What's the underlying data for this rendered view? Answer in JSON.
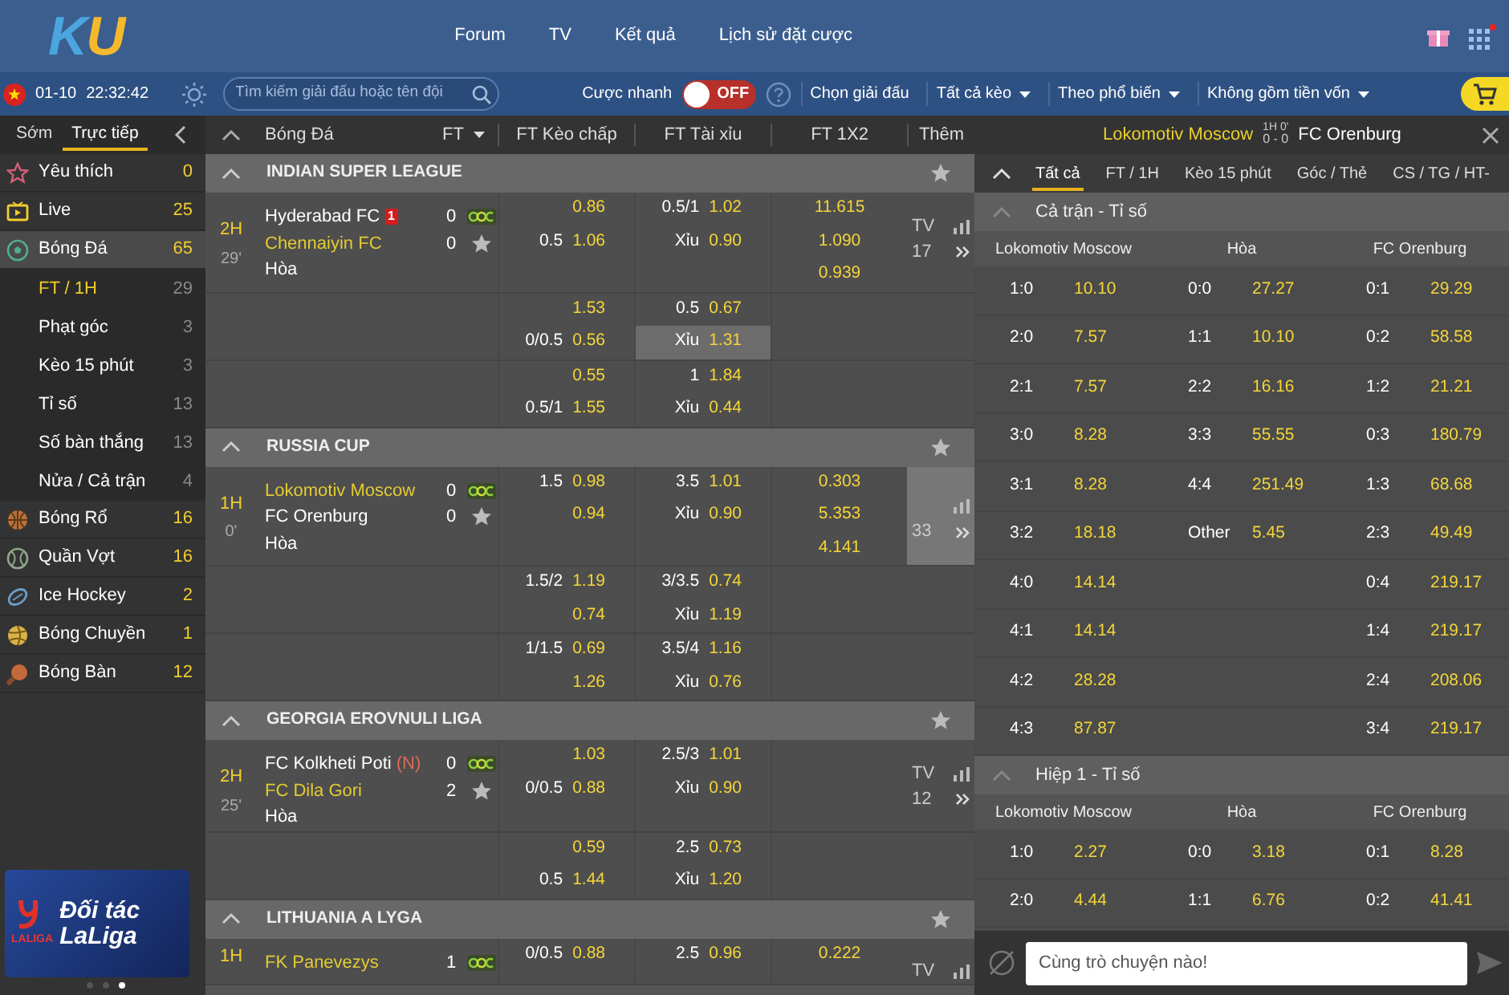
{
  "header": {
    "logo": "KU",
    "nav": [
      "Forum",
      "TV",
      "Kết quả",
      "Lịch sử đặt cược"
    ],
    "apps_badge": true
  },
  "toolbar": {
    "date": "01-10",
    "time": "22:32:42",
    "search": {
      "placeholder": "Tìm kiếm giải đấu hoặc tên đội"
    },
    "quick_bet": {
      "label": "Cược nhanh",
      "on": false,
      "state_label": "OFF"
    },
    "filters": [
      {
        "label": "Chọn giải đấu",
        "dropdown": false
      },
      {
        "label": "Tất cả kèo",
        "dropdown": true
      },
      {
        "label": "Theo phổ biến",
        "dropdown": true
      },
      {
        "label": "Không gồm tiền vốn",
        "dropdown": true
      }
    ]
  },
  "sidebar": {
    "tabs": [
      {
        "label": "Sớm",
        "selected": false
      },
      {
        "label": "Trực tiếp",
        "selected": true
      }
    ],
    "items": [
      {
        "kind": "favorites",
        "label": "Yêu thích",
        "count": "0",
        "selected": false
      },
      {
        "kind": "live",
        "label": "Live",
        "count": "25",
        "selected": false
      },
      {
        "kind": "football",
        "label": "Bóng Đá",
        "count": "65",
        "selected": true,
        "children": [
          {
            "label": "FT / 1H",
            "count": "29",
            "selected": true
          },
          {
            "label": "Phạt góc",
            "count": "3",
            "selected": false
          },
          {
            "label": "Kèo 15 phút",
            "count": "3",
            "selected": false
          },
          {
            "label": "Tỉ số",
            "count": "13",
            "selected": false
          },
          {
            "label": "Số bàn thắng",
            "count": "13",
            "selected": false
          },
          {
            "label": "Nửa / Cả trận",
            "count": "4",
            "selected": false
          }
        ]
      },
      {
        "kind": "basketball",
        "label": "Bóng Rổ",
        "count": "16",
        "selected": false
      },
      {
        "kind": "tennis",
        "label": "Quần Vợt",
        "count": "16",
        "selected": false
      },
      {
        "kind": "hockey",
        "label": "Ice Hockey",
        "count": "2",
        "selected": false
      },
      {
        "kind": "volleyball",
        "label": "Bóng Chuyền",
        "count": "1",
        "selected": false
      },
      {
        "kind": "tabletennis",
        "label": "Bóng Bàn",
        "count": "12",
        "selected": false
      }
    ],
    "banner": {
      "brand": "LALIGA",
      "title": "Đối tác LaLiga",
      "dots": [
        {
          "selected": false
        },
        {
          "selected": false
        },
        {
          "selected": true
        }
      ]
    }
  },
  "table": {
    "sport": "Bóng Đá",
    "period_filter": "FT",
    "columns": [
      "FT Kèo chấp",
      "FT Tài xỉu",
      "FT 1X2",
      "Thêm"
    ],
    "leagues": [
      {
        "name": "INDIAN SUPER LEAGUE",
        "expanded": true,
        "match": {
          "period": "2H",
          "minute": "29'",
          "teams": [
            {
              "name": "Hyderabad FC",
              "score": "0",
              "favorite": false,
              "red_cards": "1"
            },
            {
              "name": "Chennaiyin FC",
              "score": "0",
              "favorite": true
            }
          ],
          "draw": "Hòa",
          "tv": "TV",
          "count": "17",
          "selected": false,
          "blocks": [
            [
              {
                "hdp_odds": "0.86",
                "ou_line": "0.5/1",
                "ou_odds": "1.02",
                "x12": "11.615",
                "ou_selected": false
              },
              {
                "hdp_line": "0.5",
                "hdp_odds": "1.06",
                "ou_line": "Xỉu",
                "ou_odds": "0.90",
                "x12": "1.090",
                "ou_selected": false
              },
              {
                "x12": "0.939"
              }
            ],
            [
              {
                "hdp_odds": "1.53",
                "ou_line": "0.5",
                "ou_odds": "0.67",
                "ou_selected": false
              },
              {
                "hdp_line": "0/0.5",
                "hdp_odds": "0.56",
                "ou_line": "Xỉu",
                "ou_odds": "1.31",
                "ou_selected": true
              }
            ],
            [
              {
                "hdp_odds": "0.55",
                "ou_line": "1",
                "ou_odds": "1.84",
                "ou_selected": false
              },
              {
                "hdp_line": "0.5/1",
                "hdp_odds": "1.55",
                "ou_line": "Xỉu",
                "ou_odds": "0.44",
                "ou_selected": false
              }
            ]
          ]
        }
      },
      {
        "name": "RUSSIA CUP",
        "expanded": true,
        "match": {
          "period": "1H",
          "minute": "0'",
          "teams": [
            {
              "name": "Lokomotiv Moscow",
              "score": "0",
              "favorite": true
            },
            {
              "name": "FC Orenburg",
              "score": "0",
              "favorite": false
            }
          ],
          "draw": "Hòa",
          "count": "33",
          "selected": true,
          "blocks": [
            [
              {
                "hdp_line": "1.5",
                "hdp_odds": "0.98",
                "ou_line": "3.5",
                "ou_odds": "1.01",
                "x12": "0.303",
                "ou_selected": false
              },
              {
                "hdp_odds": "0.94",
                "ou_line": "Xỉu",
                "ou_odds": "0.90",
                "x12": "5.353",
                "ou_selected": false
              },
              {
                "x12": "4.141"
              }
            ],
            [
              {
                "hdp_line": "1.5/2",
                "hdp_odds": "1.19",
                "ou_line": "3/3.5",
                "ou_odds": "0.74",
                "ou_selected": false
              },
              {
                "hdp_odds": "0.74",
                "ou_line": "Xỉu",
                "ou_odds": "1.19",
                "ou_selected": false
              }
            ],
            [
              {
                "hdp_line": "1/1.5",
                "hdp_odds": "0.69",
                "ou_line": "3.5/4",
                "ou_odds": "1.16",
                "ou_selected": false
              },
              {
                "hdp_odds": "1.26",
                "ou_line": "Xỉu",
                "ou_odds": "0.76",
                "ou_selected": false
              }
            ]
          ]
        }
      },
      {
        "name": "GEORGIA EROVNULI LIGA",
        "expanded": true,
        "match": {
          "period": "2H",
          "minute": "25'",
          "teams": [
            {
              "name": "FC Kolkheti Poti",
              "tag": "(N)",
              "score": "0",
              "favorite": false
            },
            {
              "name": "FC Dila Gori",
              "score": "2",
              "favorite": true
            }
          ],
          "draw": "Hòa",
          "tv": "TV",
          "count": "12",
          "selected": false,
          "blocks": [
            [
              {
                "hdp_odds": "1.03",
                "ou_line": "2.5/3",
                "ou_odds": "1.01",
                "ou_selected": false
              },
              {
                "hdp_line": "0/0.5",
                "hdp_odds": "0.88",
                "ou_line": "Xỉu",
                "ou_odds": "0.90",
                "ou_selected": false
              }
            ],
            [
              {
                "hdp_odds": "0.59",
                "ou_line": "2.5",
                "ou_odds": "0.73",
                "ou_selected": false
              },
              {
                "hdp_line": "0.5",
                "hdp_odds": "1.44",
                "ou_line": "Xỉu",
                "ou_odds": "1.20",
                "ou_selected": false
              }
            ]
          ]
        }
      },
      {
        "name": "LITHUANIA A LYGA",
        "expanded": true,
        "match": {
          "period": "1H",
          "teams": [
            {
              "name": "FK Panevezys",
              "score": "1",
              "favorite": true
            }
          ],
          "tv": "TV",
          "selected": false,
          "blocks": [
            [
              {
                "hdp_line": "0/0.5",
                "hdp_odds": "0.88",
                "ou_line": "2.5",
                "ou_odds": "0.96",
                "x12": "0.222",
                "ou_selected": false
              }
            ]
          ]
        }
      }
    ]
  },
  "detail": {
    "home": "Lokomotiv Moscow",
    "period": "1H 0'",
    "score": "0 - 0",
    "away": "FC Orenburg",
    "tabs": [
      {
        "label": "Tất cả",
        "selected": true
      },
      {
        "label": "FT / 1H",
        "selected": false
      },
      {
        "label": "Kèo 15 phút",
        "selected": false
      },
      {
        "label": "Góc / Thẻ",
        "selected": false
      },
      {
        "label": "CS / TG / HT-",
        "selected": false
      }
    ],
    "sections": [
      {
        "title": "Cả trận - Tỉ số",
        "expanded": true,
        "columns": [
          "Lokomotiv Moscow",
          "Hòa",
          "FC Orenburg"
        ],
        "rows": [
          [
            [
              "1:0",
              "10.10"
            ],
            [
              "0:0",
              "27.27"
            ],
            [
              "0:1",
              "29.29"
            ]
          ],
          [
            [
              "2:0",
              "7.57"
            ],
            [
              "1:1",
              "10.10"
            ],
            [
              "0:2",
              "58.58"
            ]
          ],
          [
            [
              "2:1",
              "7.57"
            ],
            [
              "2:2",
              "16.16"
            ],
            [
              "1:2",
              "21.21"
            ]
          ],
          [
            [
              "3:0",
              "8.28"
            ],
            [
              "3:3",
              "55.55"
            ],
            [
              "0:3",
              "180.79"
            ]
          ],
          [
            [
              "3:1",
              "8.28"
            ],
            [
              "4:4",
              "251.49"
            ],
            [
              "1:3",
              "68.68"
            ]
          ],
          [
            [
              "3:2",
              "18.18"
            ],
            [
              "Other",
              "5.45"
            ],
            [
              "2:3",
              "49.49"
            ]
          ],
          [
            [
              "4:0",
              "14.14"
            ],
            null,
            [
              "0:4",
              "219.17"
            ]
          ],
          [
            [
              "4:1",
              "14.14"
            ],
            null,
            [
              "1:4",
              "219.17"
            ]
          ],
          [
            [
              "4:2",
              "28.28"
            ],
            null,
            [
              "2:4",
              "208.06"
            ]
          ],
          [
            [
              "4:3",
              "87.87"
            ],
            null,
            [
              "3:4",
              "219.17"
            ]
          ]
        ]
      },
      {
        "title": "Hiệp 1 - Tỉ số",
        "expanded": true,
        "columns": [
          "Lokomotiv Moscow",
          "Hòa",
          "FC Orenburg"
        ],
        "rows": [
          [
            [
              "1:0",
              "2.27"
            ],
            [
              "0:0",
              "3.18"
            ],
            [
              "0:1",
              "8.28"
            ]
          ],
          [
            [
              "2:0",
              "4.44"
            ],
            [
              "1:1",
              "6.76"
            ],
            [
              "0:2",
              "41.41"
            ]
          ]
        ]
      }
    ],
    "chat": {
      "placeholder": "Cùng trò chuyện nào!"
    }
  }
}
